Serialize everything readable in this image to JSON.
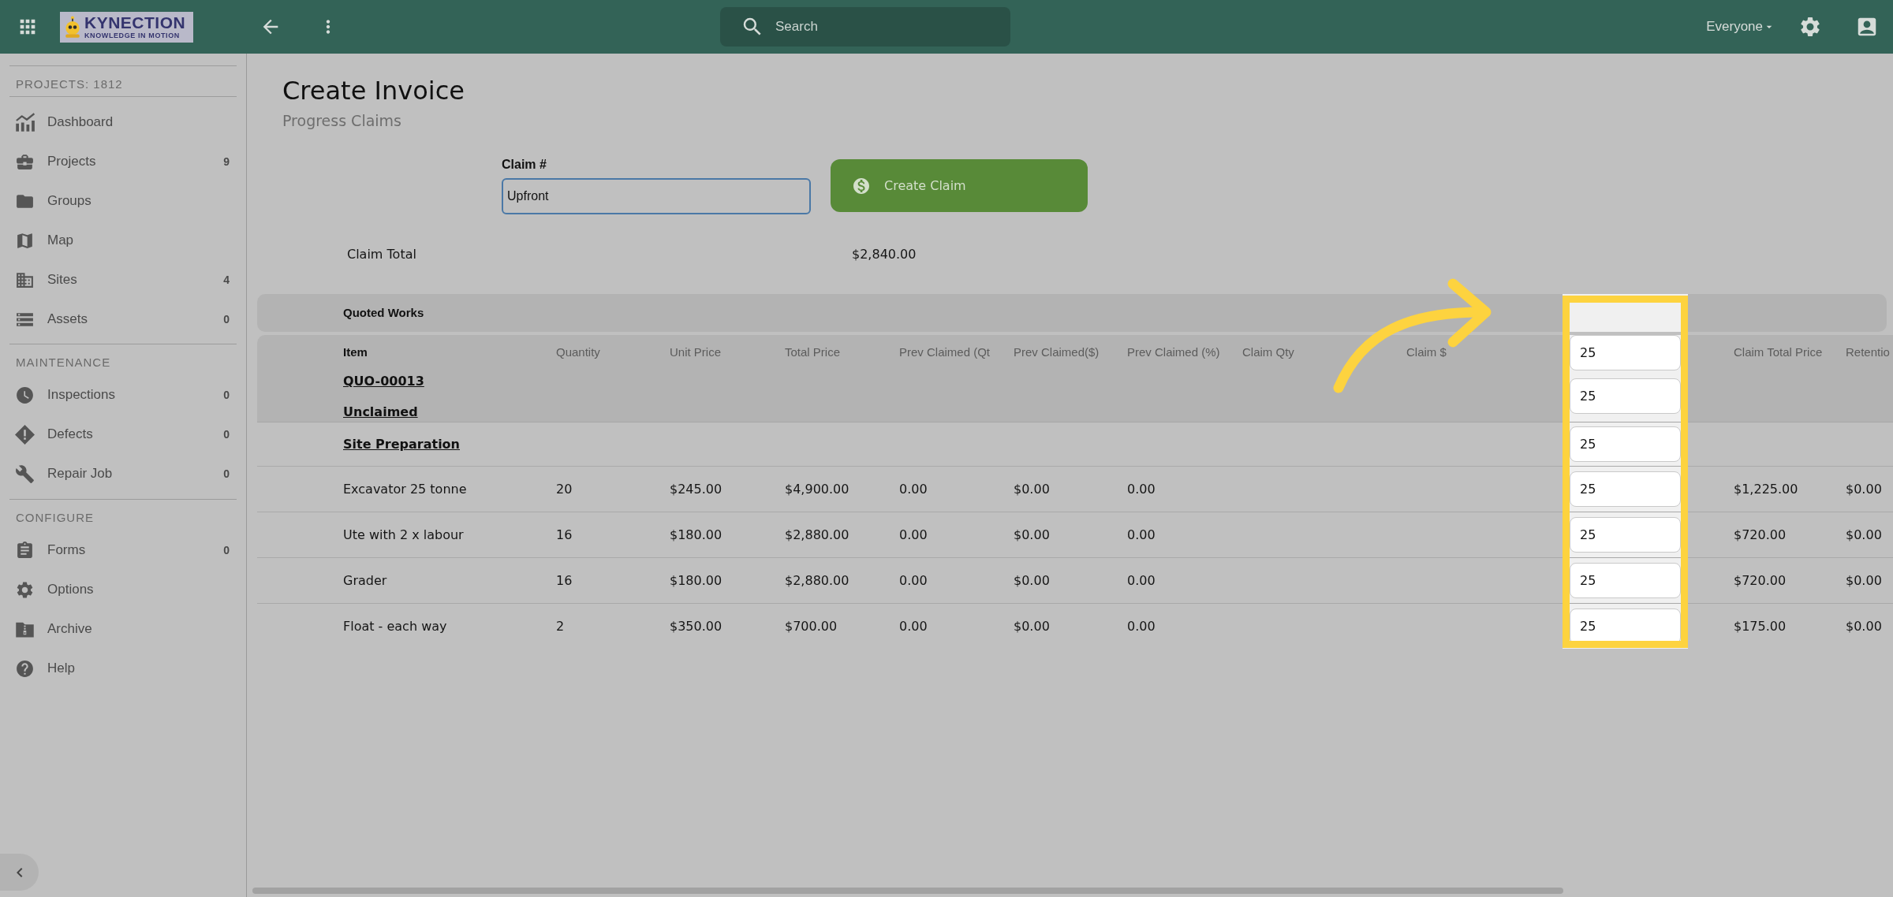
{
  "topbar": {
    "logo": {
      "wordmark": "KYNECTION",
      "tagline": "KNOWLEDGE IN MOTION"
    },
    "search": {
      "placeholder": "Search"
    },
    "audience": "Everyone"
  },
  "sidebar": {
    "header": "PROJECTS: 1812",
    "sections": [
      {
        "items": [
          {
            "label": "Dashboard"
          },
          {
            "label": "Projects",
            "count": "9"
          },
          {
            "label": "Groups"
          },
          {
            "label": "Map"
          },
          {
            "label": "Sites",
            "count": "4"
          },
          {
            "label": "Assets",
            "count": "0"
          }
        ]
      },
      {
        "title": "MAINTENANCE",
        "items": [
          {
            "label": "Inspections",
            "count": "0"
          },
          {
            "label": "Defects",
            "count": "0"
          },
          {
            "label": "Repair Job",
            "count": "0"
          }
        ]
      },
      {
        "title": "CONFIGURE",
        "items": [
          {
            "label": "Forms",
            "count": "0"
          },
          {
            "label": "Options"
          },
          {
            "label": "Archive"
          },
          {
            "label": "Help"
          }
        ]
      }
    ]
  },
  "page": {
    "title": "Create Invoice",
    "subtitle": "Progress Claims"
  },
  "claim_form": {
    "label": "Claim #",
    "value": "Upfront",
    "button": "Create Claim"
  },
  "claim_total": {
    "label": "Claim Total",
    "value": "$2,840.00"
  },
  "table": {
    "section": "Quoted Works",
    "columns": [
      {
        "label": "Item",
        "highlighted": false
      },
      {
        "label": "Quantity",
        "highlighted": false
      },
      {
        "label": "Unit Price",
        "highlighted": false
      },
      {
        "label": "Total Price",
        "highlighted": false
      },
      {
        "label": "Prev Claimed (Qt",
        "highlighted": false
      },
      {
        "label": "Prev Claimed($)",
        "highlighted": false
      },
      {
        "label": "Prev Claimed (%)",
        "highlighted": false
      },
      {
        "label": "Claim Qty",
        "highlighted": false
      },
      {
        "label": "Claim $",
        "highlighted": false
      },
      {
        "value": "25",
        "highlighted": true
      },
      {
        "label": "Claim Total Price",
        "highlighted": false
      },
      {
        "label": "Retentio",
        "highlighted": false
      }
    ],
    "rows": [
      {
        "kind": "group",
        "lines": [
          "QUO-00013",
          "Unclaimed"
        ],
        "column_10": "25"
      },
      {
        "kind": "section",
        "title": "Site Preparation",
        "column_10": "25"
      },
      {
        "kind": "item",
        "item": "Excavator 25 tonne",
        "quantity": "20",
        "unit_price": "$245.00",
        "total_price": "$4,900.00",
        "prev_claimed_qty": "0.00",
        "prev_claimed_amount": "$0.00",
        "prev_claimed_pct": "0.00",
        "column_10": "25",
        "claim_total_price": "$1,225.00",
        "retention": "$0.00"
      },
      {
        "kind": "item",
        "item": "Ute with 2 x labour",
        "quantity": "16",
        "unit_price": "$180.00",
        "total_price": "$2,880.00",
        "prev_claimed_qty": "0.00",
        "prev_claimed_amount": "$0.00",
        "prev_claimed_pct": "0.00",
        "column_10": "25",
        "claim_total_price": "$720.00",
        "retention": "$0.00"
      },
      {
        "kind": "item",
        "item": "Grader",
        "quantity": "16",
        "unit_price": "$180.00",
        "total_price": "$2,880.00",
        "prev_claimed_qty": "0.00",
        "prev_claimed_amount": "$0.00",
        "prev_claimed_pct": "0.00",
        "column_10": "25",
        "claim_total_price": "$720.00",
        "retention": "$0.00"
      },
      {
        "kind": "item",
        "item": "Float - each way",
        "quantity": "2",
        "unit_price": "$350.00",
        "total_price": "$700.00",
        "prev_claimed_qty": "0.00",
        "prev_claimed_amount": "$0.00",
        "prev_claimed_pct": "0.00",
        "column_10": "25",
        "claim_total_price": "$175.00",
        "retention": "$0.00"
      }
    ]
  }
}
